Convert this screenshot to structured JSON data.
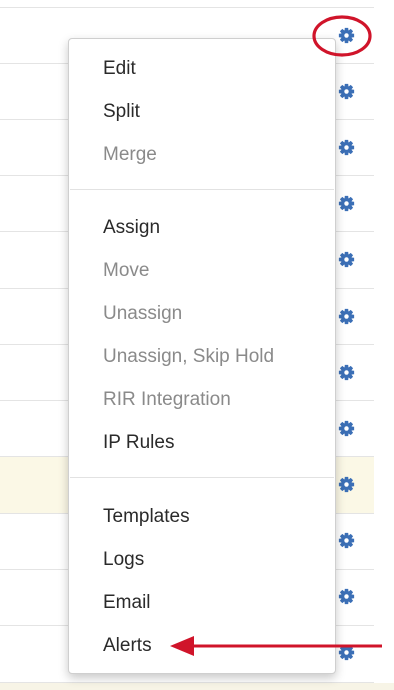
{
  "table": {
    "rows": [
      {
        "highlighted": false
      },
      {
        "highlighted": false
      },
      {
        "highlighted": false
      },
      {
        "highlighted": false
      },
      {
        "highlighted": false
      },
      {
        "highlighted": false
      },
      {
        "highlighted": false
      },
      {
        "highlighted": false
      },
      {
        "highlighted": true
      },
      {
        "highlighted": false
      },
      {
        "highlighted": false
      },
      {
        "highlighted": false
      }
    ],
    "gear_icon": "gear-icon",
    "gear_color": "#3b6fb6"
  },
  "menu": {
    "sections": [
      {
        "items": [
          {
            "label": "Edit",
            "enabled": true
          },
          {
            "label": "Split",
            "enabled": true
          },
          {
            "label": "Merge",
            "enabled": false
          }
        ]
      },
      {
        "items": [
          {
            "label": "Assign",
            "enabled": true
          },
          {
            "label": "Move",
            "enabled": false
          },
          {
            "label": "Unassign",
            "enabled": false
          },
          {
            "label": "Unassign, Skip Hold",
            "enabled": false
          },
          {
            "label": "RIR Integration",
            "enabled": false
          },
          {
            "label": "IP Rules",
            "enabled": true
          }
        ]
      },
      {
        "items": [
          {
            "label": "Templates",
            "enabled": true
          },
          {
            "label": "Logs",
            "enabled": true
          },
          {
            "label": "Email",
            "enabled": true
          },
          {
            "label": "Alerts",
            "enabled": true
          }
        ]
      }
    ],
    "text_color": "#2a2a2a",
    "disabled_color": "#8a8a8a"
  },
  "annotations": {
    "color": "#d0142a",
    "circle_target": "gear-icon",
    "arrow_target": "Alerts"
  }
}
